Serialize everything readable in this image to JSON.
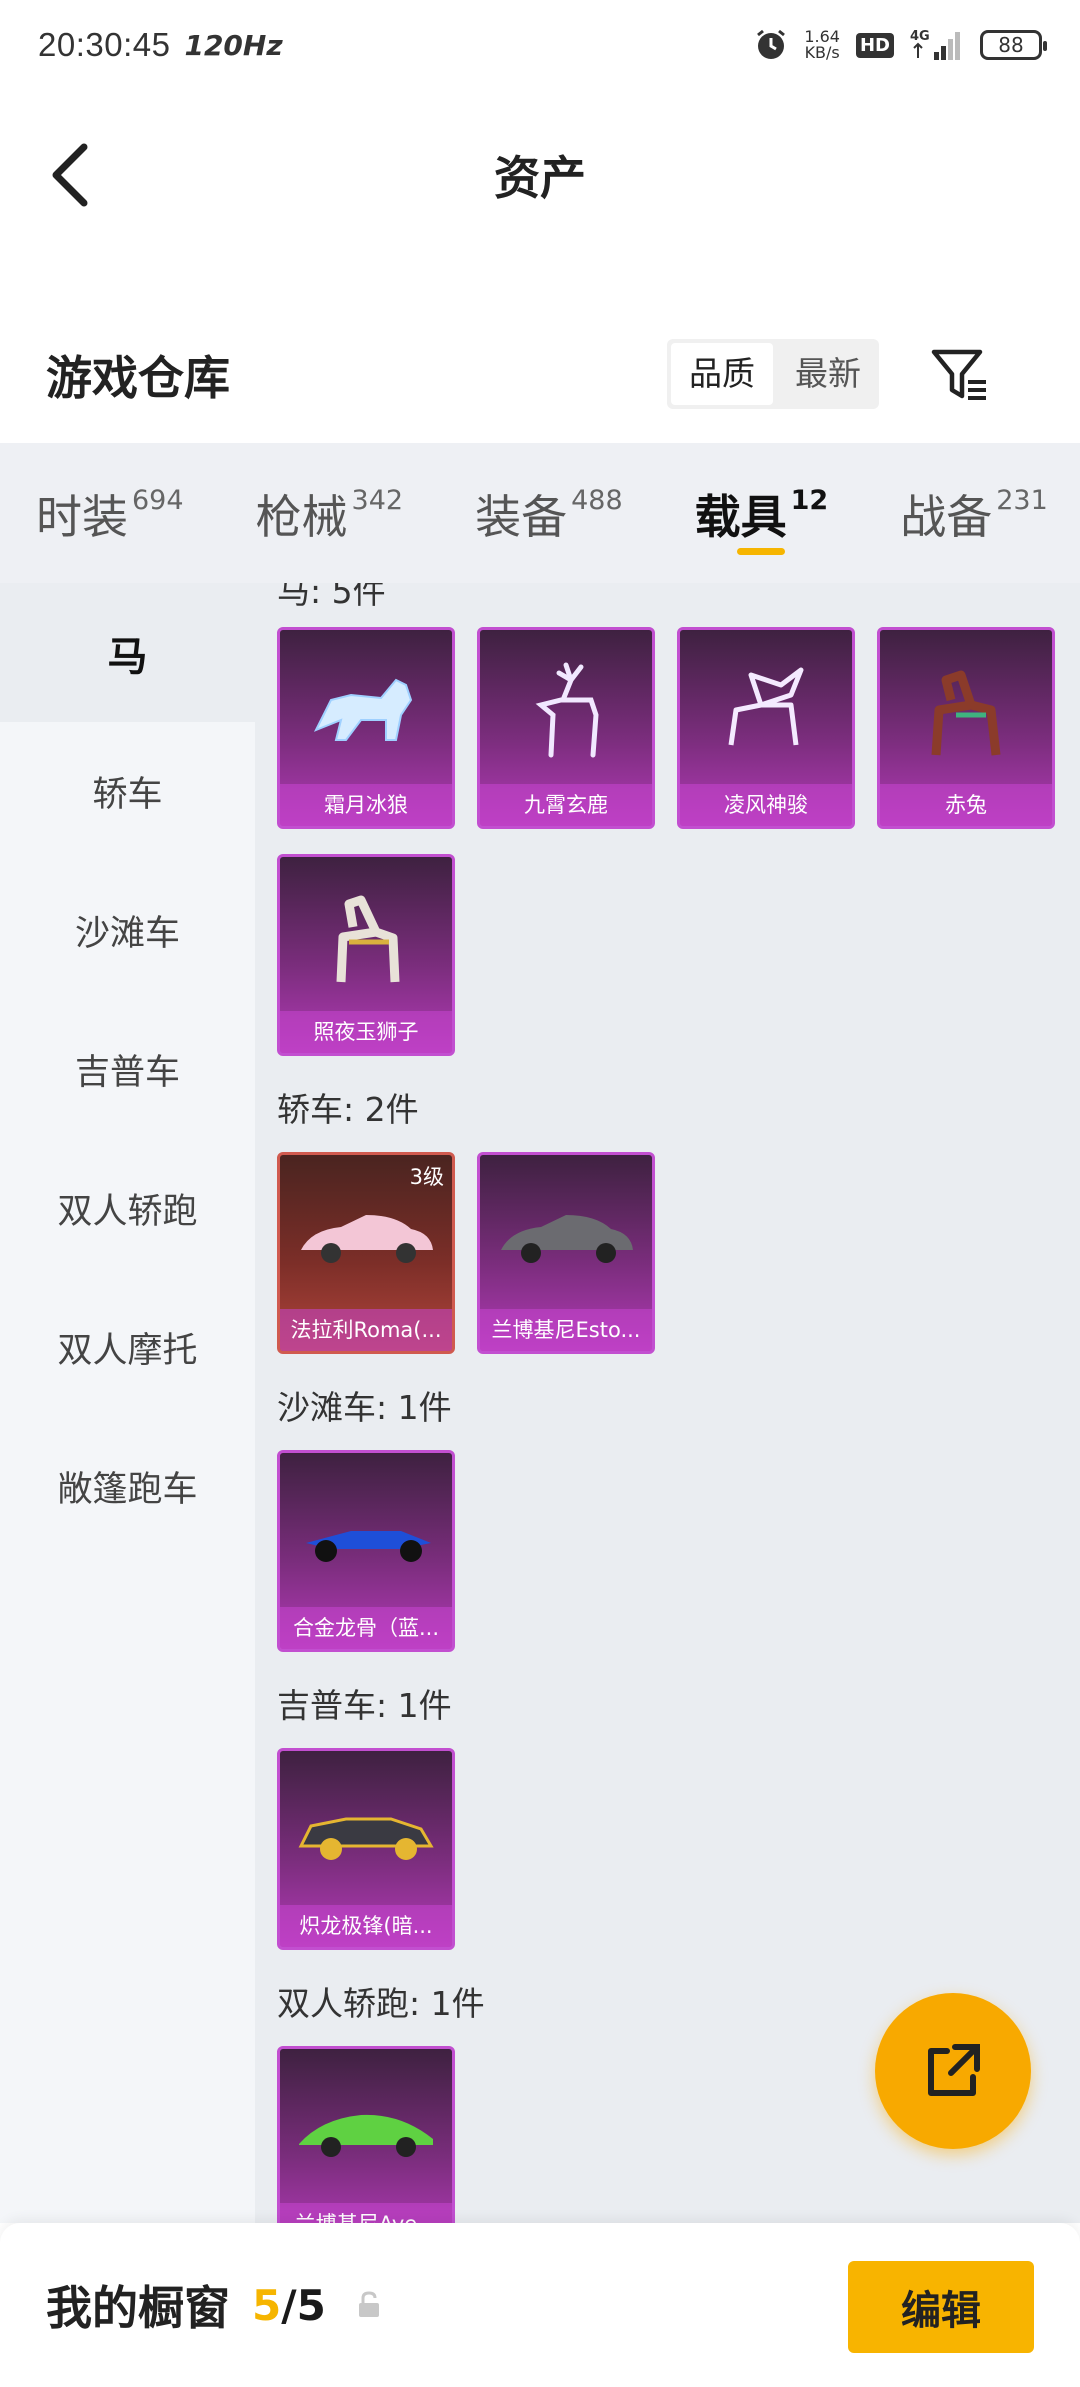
{
  "status_bar": {
    "time": "20:30:45",
    "refresh": "120Hz",
    "net_speed_value": "1.64",
    "net_speed_unit": "KB/s",
    "hd": "HD",
    "network": "4G",
    "battery": "88"
  },
  "header": {
    "title": "资产"
  },
  "warehouse": {
    "title": "游戏仓库",
    "sort_options": [
      "品质",
      "最新"
    ],
    "active_sort": "品质"
  },
  "tabs": [
    {
      "label": "时装",
      "count": "694"
    },
    {
      "label": "枪械",
      "count": "342"
    },
    {
      "label": "装备",
      "count": "488"
    },
    {
      "label": "载具",
      "count": "12"
    },
    {
      "label": "战备",
      "count": "231"
    }
  ],
  "active_tab": "载具",
  "sidebar": {
    "items": [
      "马",
      "轿车",
      "沙滩车",
      "吉普车",
      "双人轿跑",
      "双人摩托",
      "敞篷跑车"
    ],
    "active": "马"
  },
  "sections": {
    "horse": {
      "title": "马: 5件",
      "items": [
        "霜月冰狼",
        "九霄玄鹿",
        "凌风神骏",
        "赤兔",
        "照夜玉狮子"
      ]
    },
    "sedan": {
      "title": "轿车: 2件",
      "items": [
        "法拉利Roma(...",
        "兰博基尼Esto..."
      ],
      "level": "3级"
    },
    "beach": {
      "title": "沙滩车: 1件",
      "items": [
        "合金龙骨（蓝..."
      ]
    },
    "jeep": {
      "title": "吉普车: 1件",
      "items": [
        "炽龙极锋(暗..."
      ]
    },
    "coupe": {
      "title": "双人轿跑: 1件",
      "items": [
        "兰博基尼Ave..."
      ]
    }
  },
  "bottom_bar": {
    "title": "我的橱窗",
    "count_current": "5",
    "count_total": "/5",
    "edit_label": "编辑"
  },
  "colors": {
    "accent": "#f6b500",
    "card_purple": "#b23ab6",
    "card_red": "#b2453c"
  }
}
